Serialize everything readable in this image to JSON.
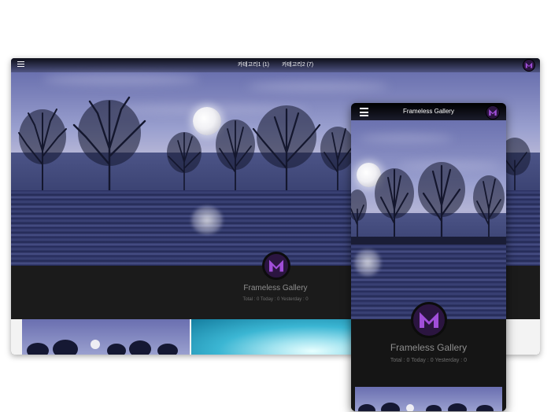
{
  "desktop": {
    "menu": [
      "카테고리1 (1)",
      "카테고리2 (7)"
    ],
    "gallery_title": "Frameless Gallery",
    "stats": "Total : 0 Today : 0 Yesterday : 0"
  },
  "mobile": {
    "header_title": "Frameless Gallery",
    "gallery_title": "Frameless Gallery",
    "stats": "Total : 0 Today : 0 Yesterday : 0"
  },
  "icons": {
    "menu": "hamburger-icon",
    "avatar": "purple-m-logo"
  },
  "colors": {
    "logo_bg": "#2b1540",
    "logo_fg": "#a04ed8",
    "info_bg": "#1b1b1b"
  }
}
